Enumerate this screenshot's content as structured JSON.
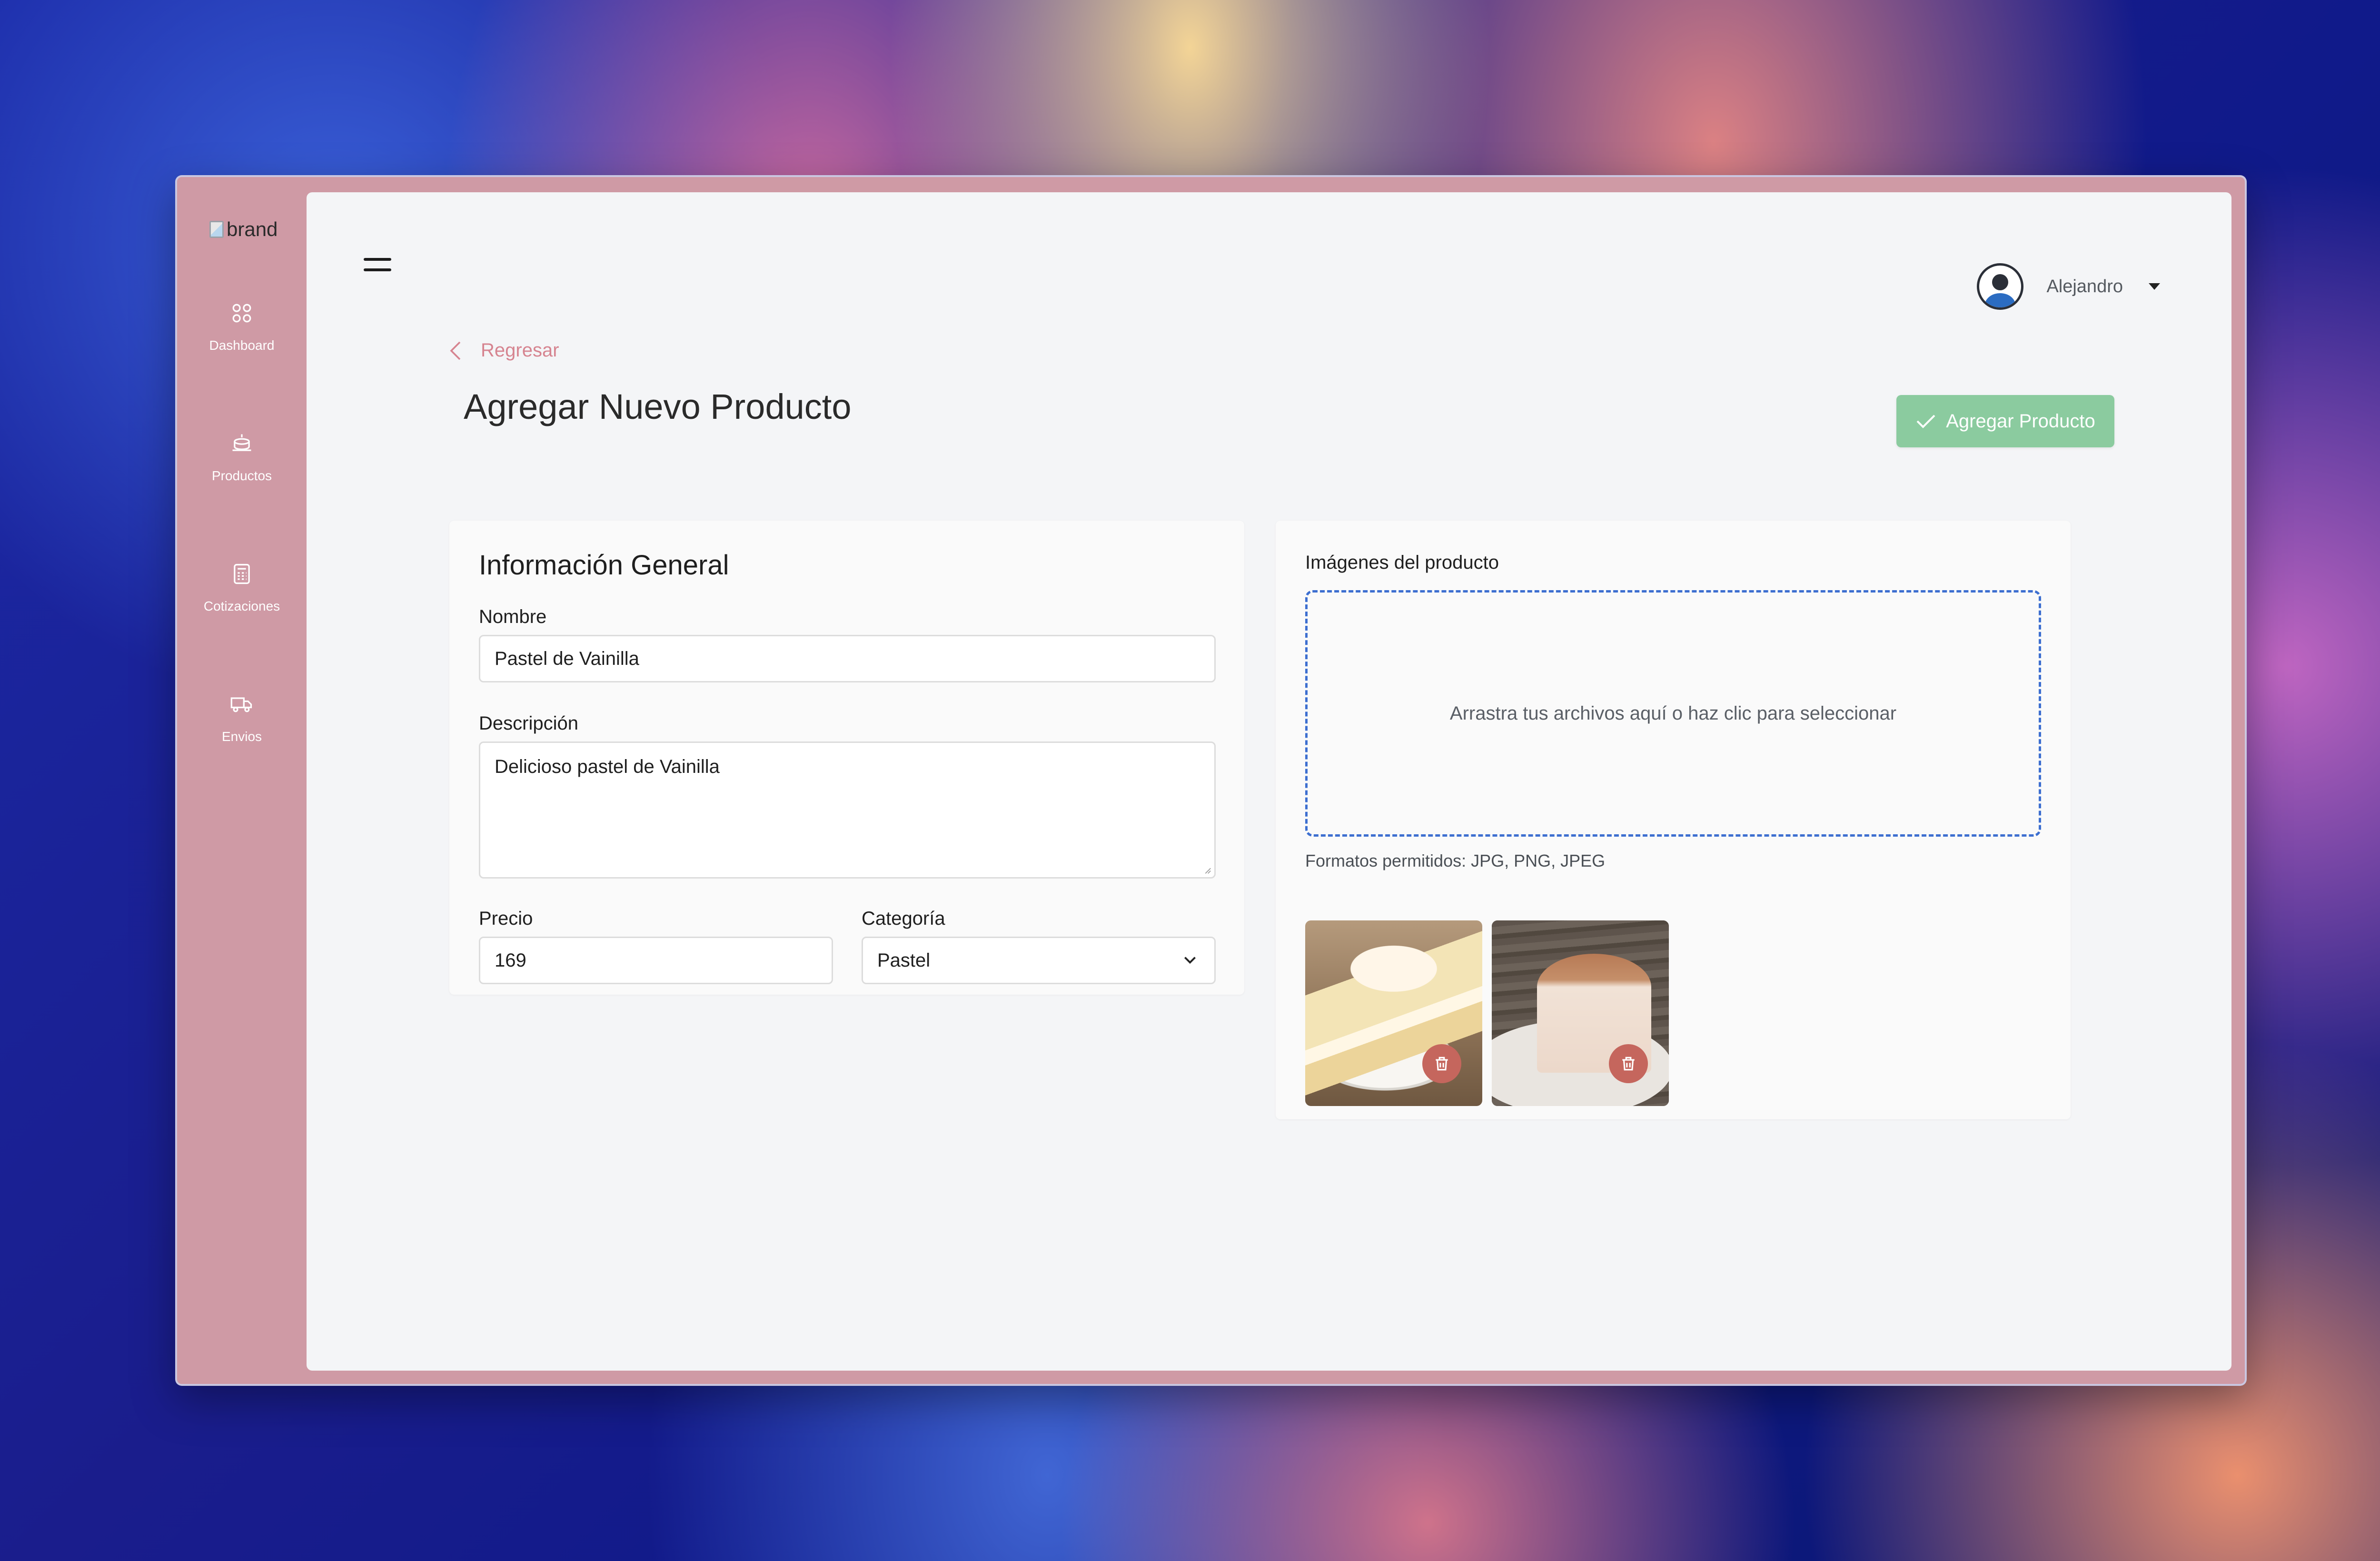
{
  "brand": {
    "alt_text": "brand"
  },
  "sidebar": {
    "items": [
      {
        "label": "Dashboard",
        "icon": "grid-icon"
      },
      {
        "label": "Productos",
        "icon": "cake-icon"
      },
      {
        "label": "Cotizaciones",
        "icon": "calculator-icon"
      },
      {
        "label": "Envios",
        "icon": "truck-icon"
      }
    ]
  },
  "header": {
    "user_name": "Alejandro"
  },
  "page": {
    "back_label": "Regresar",
    "title": "Agregar Nuevo Producto",
    "submit_label": "Agregar Producto"
  },
  "general": {
    "title": "Información General",
    "name_label": "Nombre",
    "name_value": "Pastel de Vainilla",
    "description_label": "Descripción",
    "description_value": "Delicioso pastel de Vainilla",
    "price_label": "Precio",
    "price_value": "169",
    "category_label": "Categoría",
    "category_value": "Pastel"
  },
  "images": {
    "title": "Imágenes del producto",
    "drop_text": "Arrastra tus archivos aquí o haz clic para seleccionar",
    "formats_note": "Formatos permitidos: JPG, PNG, JPEG",
    "thumbnails": [
      {
        "subject": "vanilla cake slice on plate"
      },
      {
        "subject": "round cake with caramel lattice"
      }
    ]
  },
  "colors": {
    "sidebar_bg": "#cf9aa5",
    "accent_pink": "#d68490",
    "success_button": "#8bcb9f",
    "dropzone_border": "#3d6fd0",
    "delete_button": "#c5665d"
  }
}
